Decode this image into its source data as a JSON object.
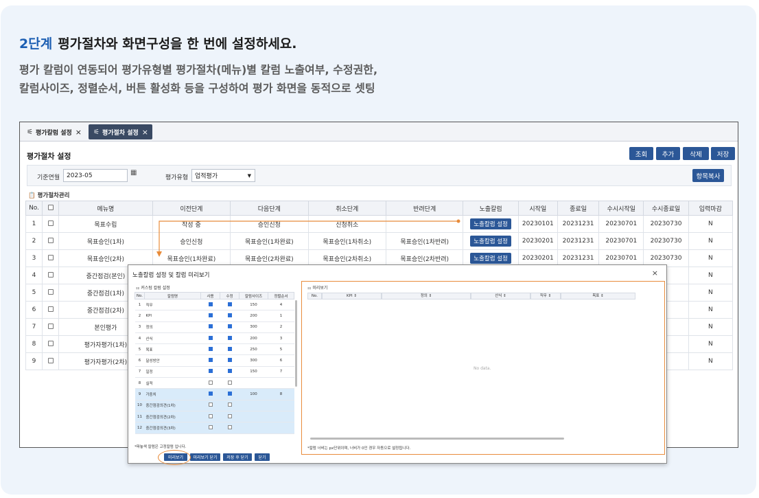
{
  "hero": {
    "step": "2단계",
    "title": "평가절차와 화면구성을 한 번에 설정하세요.",
    "desc_line1": "평가 칼럼이 연동되어 평가유형별 평가절차(메뉴)별 칼럼 노출여부, 수정권한,",
    "desc_line2": "칼럼사이즈, 정렬순서, 버튼 활성화 등을 구성하여 평가 화면을 동적으로 셋팅"
  },
  "tabs": [
    {
      "label": "평가칼럼 설정",
      "icon": "sliders-icon",
      "close": "×"
    },
    {
      "label": "평가절차 설정",
      "icon": "sliders-icon",
      "close": "×"
    }
  ],
  "page": {
    "title": "평가절차 설정",
    "buttons": {
      "search": "조회",
      "add": "추가",
      "delete": "삭제",
      "save": "저장"
    },
    "copy_button": "항목복사",
    "section_label": "평가절차관리",
    "section_icon": "clipboard-icon"
  },
  "filter": {
    "month_label": "기준연월",
    "month_value": "2023-05",
    "type_label": "평가유형",
    "type_value": "업적평가",
    "calendar_icon": "calendar-icon",
    "dropdown_icon": "caret-down-icon"
  },
  "grid": {
    "headers": [
      "No.",
      "",
      "메뉴명",
      "이전단계",
      "다음단계",
      "취소단계",
      "반려단계",
      "노출칼럼",
      "시작일",
      "종료일",
      "수시시작일",
      "수시종료일",
      "입력마감"
    ],
    "rows": [
      {
        "no": "1",
        "menu": "목표수립",
        "prev": "작성 중",
        "next": "승인신청",
        "cancel": "신청취소",
        "reject": "",
        "btn": "노출칼럼 설정",
        "start": "20230101",
        "end": "20231231",
        "adhoc_start": "20230701",
        "adhoc_end": "20230730",
        "close": "N"
      },
      {
        "no": "2",
        "menu": "목표승인(1차)",
        "prev": "승인신청",
        "next": "목표승인(1차완료)",
        "cancel": "목표승인(1차취소)",
        "reject": "목표승인(1차반려)",
        "btn": "노출칼럼 설정",
        "start": "20230201",
        "end": "20231231",
        "adhoc_start": "20230701",
        "adhoc_end": "20230730",
        "close": "N"
      },
      {
        "no": "3",
        "menu": "목표승인(2차)",
        "prev": "목표승인(1차완료)",
        "next": "목표승인(2차완료)",
        "cancel": "목표승인(2차취소)",
        "reject": "목표승인(2차반려)",
        "btn": "노출칼럼 설정",
        "start": "20230201",
        "end": "20231231",
        "adhoc_start": "20230701",
        "adhoc_end": "20230730",
        "close": "N"
      },
      {
        "no": "4",
        "menu": "중간점검(본인)",
        "close": "N"
      },
      {
        "no": "5",
        "menu": "중간점검(1차)",
        "close": "N"
      },
      {
        "no": "6",
        "menu": "중간점검(2차)",
        "close": "N"
      },
      {
        "no": "7",
        "menu": "본인평가",
        "close": "N"
      },
      {
        "no": "8",
        "menu": "평가자평가(1차)",
        "close": "N"
      },
      {
        "no": "9",
        "menu": "평가자평가(2차)",
        "close": "N"
      }
    ]
  },
  "modal": {
    "title": "노출칼럼 설정 및 칼럼 미리보기",
    "close": "×",
    "left_label": "커스텀 칼럼 설정",
    "right_label": "미리보기",
    "headers": [
      "No.",
      "칼럼명",
      "사용",
      "수정",
      "칼럼사이즈",
      "정렬순서"
    ],
    "rows": [
      {
        "no": "1",
        "name": "직무",
        "use": true,
        "edit": true,
        "size": "150",
        "order": "4"
      },
      {
        "no": "2",
        "name": "KPI",
        "use": true,
        "edit": true,
        "size": "200",
        "order": "1"
      },
      {
        "no": "3",
        "name": "정의",
        "use": true,
        "edit": true,
        "size": "300",
        "order": "2"
      },
      {
        "no": "4",
        "name": "산식",
        "use": true,
        "edit": true,
        "size": "200",
        "order": "3"
      },
      {
        "no": "5",
        "name": "목표",
        "use": true,
        "edit": true,
        "size": "250",
        "order": "5"
      },
      {
        "no": "6",
        "name": "달성방안",
        "use": true,
        "edit": true,
        "size": "300",
        "order": "6"
      },
      {
        "no": "7",
        "name": "일정",
        "use": true,
        "edit": true,
        "size": "150",
        "order": "7"
      },
      {
        "no": "8",
        "name": "실적",
        "use": false,
        "edit": false,
        "size": "",
        "order": ""
      },
      {
        "no": "9",
        "name": "가중치",
        "use": true,
        "edit": true,
        "size": "100",
        "order": "8"
      },
      {
        "no": "10",
        "name": "중간점검의견(1차)",
        "use": false,
        "edit": false,
        "size": "",
        "order": ""
      },
      {
        "no": "11",
        "name": "중간점검의견(2차)",
        "use": false,
        "edit": false,
        "size": "",
        "order": ""
      },
      {
        "no": "12",
        "name": "중간점검의견(3차)",
        "use": false,
        "edit": false,
        "size": "",
        "order": ""
      }
    ],
    "preview_headers": [
      "No.",
      "KPI ⇕",
      "정의 ⇕",
      "산식 ⇕",
      "직무 ⇕",
      "목표 ⇕"
    ],
    "no_data": "No data.",
    "note_left": "*파놓색 칼럼은 고정칼럼 입니다.",
    "note_right": "*칼럼 너비는 px단위이며, 너비가 0인 경우 자동으로 설정됩니다.",
    "buttons": {
      "preview": "미리보기",
      "preview_close": "미리보기 닫기",
      "save_close": "저장 후 닫기",
      "close": "닫기"
    }
  },
  "colors": {
    "accent": "#1d5fb3",
    "button": "#2b5797",
    "highlight": "#e88b3a",
    "selected_row": "#d9ebfa"
  }
}
